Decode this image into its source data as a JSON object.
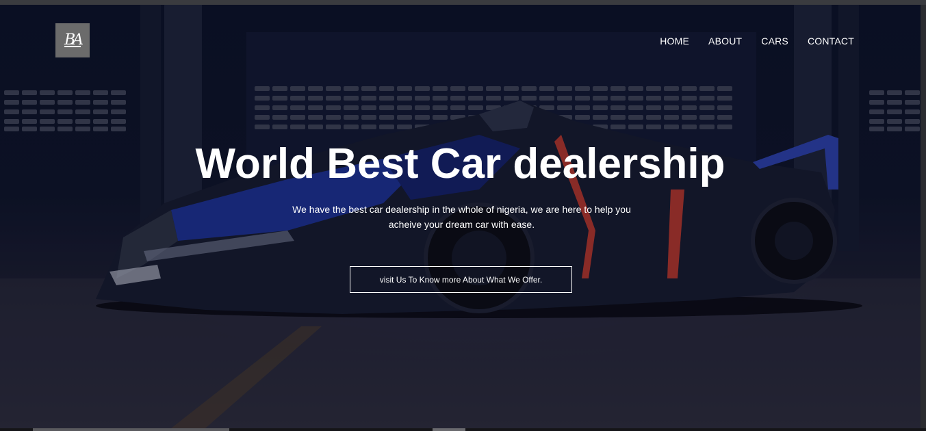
{
  "brand": {
    "logo_text": "BA"
  },
  "nav": {
    "items": [
      {
        "label": "HOME"
      },
      {
        "label": "ABOUT"
      },
      {
        "label": "CARS"
      },
      {
        "label": "CONTACT"
      }
    ]
  },
  "hero": {
    "title": "World Best Car dealership",
    "subtitle": "We have the best car dealership in the whole of nigeria, we are here to help you acheive your dream car with ease.",
    "cta_label": "visit Us To Know more About What We Offer.",
    "background_image": "race-car-in-garage"
  },
  "colors": {
    "text": "#ffffff",
    "logo_bg": "#6b6b6b",
    "hero_bg": "#0e1428"
  }
}
